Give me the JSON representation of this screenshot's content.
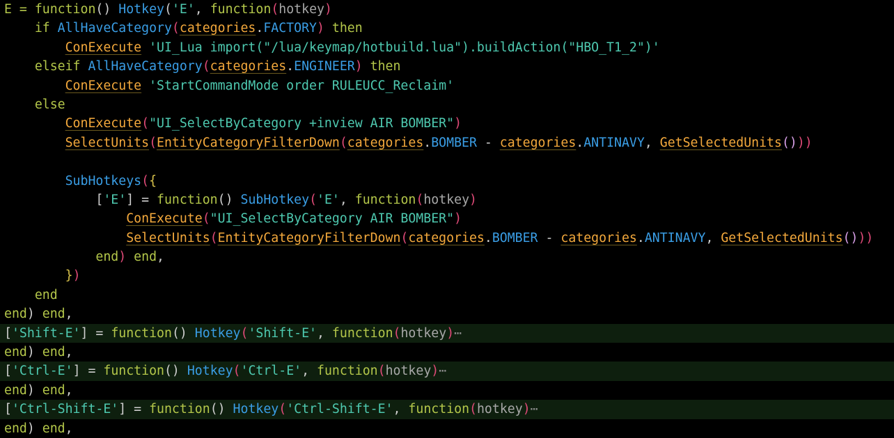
{
  "colors": {
    "background": "#000000",
    "folded_line_bg": "#0e1f0e",
    "keyword": "#b4c74a",
    "function_name": "#3a9ee6",
    "call": "#f4a93c",
    "string": "#4ec9b0",
    "paren": "#e04a78"
  },
  "lines": [
    [
      [
        "kw",
        "E = "
      ],
      [
        "kw",
        "function"
      ],
      [
        "punc",
        "() "
      ],
      [
        "fn",
        "Hotkey"
      ],
      [
        "punc",
        "("
      ],
      [
        "str",
        "'E'"
      ],
      [
        "punc",
        ", "
      ],
      [
        "kw",
        "function"
      ],
      [
        "paren",
        "("
      ],
      [
        "param",
        "hotkey"
      ],
      [
        "paren",
        ")"
      ]
    ],
    [
      [
        "punc",
        "    "
      ],
      [
        "kw",
        "if "
      ],
      [
        "fn",
        "AllHaveCategory"
      ],
      [
        "paren",
        "("
      ],
      [
        "callu",
        "categories"
      ],
      [
        "punc",
        "."
      ],
      [
        "prop",
        "FACTORY"
      ],
      [
        "paren",
        ")"
      ],
      [
        "kw",
        " then"
      ]
    ],
    [
      [
        "punc",
        "        "
      ],
      [
        "callu",
        "ConExecute"
      ],
      [
        "str",
        " 'UI_Lua import(\"/lua/keymap/hotbuild.lua\").buildAction(\"HBO_T1_2\")'"
      ]
    ],
    [
      [
        "punc",
        "    "
      ],
      [
        "kw",
        "elseif "
      ],
      [
        "fn",
        "AllHaveCategory"
      ],
      [
        "paren",
        "("
      ],
      [
        "callu",
        "categories"
      ],
      [
        "punc",
        "."
      ],
      [
        "prop",
        "ENGINEER"
      ],
      [
        "paren",
        ")"
      ],
      [
        "kw",
        " then"
      ]
    ],
    [
      [
        "punc",
        "        "
      ],
      [
        "callu",
        "ConExecute"
      ],
      [
        "str",
        " 'StartCommandMode order RULEUCC_Reclaim'"
      ]
    ],
    [
      [
        "punc",
        "    "
      ],
      [
        "kw",
        "else"
      ]
    ],
    [
      [
        "punc",
        "        "
      ],
      [
        "callu",
        "ConExecute"
      ],
      [
        "paren",
        "("
      ],
      [
        "str",
        "\"UI_SelectByCategory +inview AIR BOMBER\""
      ],
      [
        "paren",
        ")"
      ]
    ],
    [
      [
        "punc",
        "        "
      ],
      [
        "callu",
        "SelectUnits"
      ],
      [
        "paren",
        "("
      ],
      [
        "callu",
        "EntityCategoryFilterDown"
      ],
      [
        "paren",
        "("
      ],
      [
        "callu",
        "categories"
      ],
      [
        "punc",
        "."
      ],
      [
        "prop",
        "BOMBER"
      ],
      [
        "punc",
        " - "
      ],
      [
        "callu",
        "categories"
      ],
      [
        "punc",
        "."
      ],
      [
        "prop",
        "ANTINAVY"
      ],
      [
        "punc",
        ", "
      ],
      [
        "callu",
        "GetSelectedUnits"
      ],
      [
        "paren2",
        "()"
      ],
      [
        "paren",
        "))"
      ]
    ],
    [
      [
        "punc",
        " "
      ]
    ],
    [
      [
        "punc",
        "        "
      ],
      [
        "fn",
        "SubHotkeys"
      ],
      [
        "paren",
        "("
      ],
      [
        "brace",
        "{"
      ]
    ],
    [
      [
        "punc",
        "            "
      ],
      [
        "punc",
        "["
      ],
      [
        "str",
        "'E'"
      ],
      [
        "punc",
        "] = "
      ],
      [
        "kw",
        "function"
      ],
      [
        "punc",
        "() "
      ],
      [
        "fn",
        "SubHotkey"
      ],
      [
        "paren",
        "("
      ],
      [
        "str",
        "'E'"
      ],
      [
        "punc",
        ", "
      ],
      [
        "kw",
        "function"
      ],
      [
        "paren",
        "("
      ],
      [
        "param",
        "hotkey"
      ],
      [
        "paren",
        ")"
      ]
    ],
    [
      [
        "punc",
        "                "
      ],
      [
        "callu",
        "ConExecute"
      ],
      [
        "paren",
        "("
      ],
      [
        "str",
        "\"UI_SelectByCategory AIR BOMBER\""
      ],
      [
        "paren",
        ")"
      ]
    ],
    [
      [
        "punc",
        "                "
      ],
      [
        "callu",
        "SelectUnits"
      ],
      [
        "paren",
        "("
      ],
      [
        "callu",
        "EntityCategoryFilterDown"
      ],
      [
        "paren",
        "("
      ],
      [
        "callu",
        "categories"
      ],
      [
        "punc",
        "."
      ],
      [
        "prop",
        "BOMBER"
      ],
      [
        "punc",
        " - "
      ],
      [
        "callu",
        "categories"
      ],
      [
        "punc",
        "."
      ],
      [
        "prop",
        "ANTINAVY"
      ],
      [
        "punc",
        ", "
      ],
      [
        "callu",
        "GetSelectedUnits"
      ],
      [
        "paren2",
        "()"
      ],
      [
        "paren",
        "))"
      ]
    ],
    [
      [
        "punc",
        "            "
      ],
      [
        "kw",
        "end"
      ],
      [
        "paren",
        ")"
      ],
      [
        "kw",
        " end"
      ],
      [
        "punc",
        ","
      ]
    ],
    [
      [
        "punc",
        "        "
      ],
      [
        "brace",
        "}"
      ],
      [
        "paren",
        ")"
      ]
    ],
    [
      [
        "punc",
        "    "
      ],
      [
        "kw",
        "end"
      ]
    ],
    [
      [
        "kw",
        "end"
      ],
      [
        "punc",
        ") "
      ],
      [
        "kw",
        "end"
      ],
      [
        "punc",
        ","
      ]
    ],
    [
      [
        "punc",
        "["
      ],
      [
        "str",
        "'Shift-E'"
      ],
      [
        "punc",
        "] = "
      ],
      [
        "kw",
        "function"
      ],
      [
        "punc",
        "() "
      ],
      [
        "fn",
        "Hotkey"
      ],
      [
        "paren",
        "("
      ],
      [
        "str",
        "'Shift-E'"
      ],
      [
        "punc",
        ", "
      ],
      [
        "kw",
        "function"
      ],
      [
        "paren",
        "("
      ],
      [
        "param",
        "hotkey"
      ],
      [
        "paren",
        ")"
      ],
      [
        "ellipsis",
        "⋯"
      ]
    ],
    [
      [
        "kw",
        "end"
      ],
      [
        "punc",
        ") "
      ],
      [
        "kw",
        "end"
      ],
      [
        "punc",
        ","
      ]
    ],
    [
      [
        "punc",
        "["
      ],
      [
        "str",
        "'Ctrl-E'"
      ],
      [
        "punc",
        "] = "
      ],
      [
        "kw",
        "function"
      ],
      [
        "punc",
        "() "
      ],
      [
        "fn",
        "Hotkey"
      ],
      [
        "paren",
        "("
      ],
      [
        "str",
        "'Ctrl-E'"
      ],
      [
        "punc",
        ", "
      ],
      [
        "kw",
        "function"
      ],
      [
        "paren",
        "("
      ],
      [
        "param",
        "hotkey"
      ],
      [
        "paren",
        ")"
      ],
      [
        "ellipsis",
        "⋯"
      ]
    ],
    [
      [
        "kw",
        "end"
      ],
      [
        "punc",
        ") "
      ],
      [
        "kw",
        "end"
      ],
      [
        "punc",
        ","
      ]
    ],
    [
      [
        "punc",
        "["
      ],
      [
        "str",
        "'Ctrl-Shift-E'"
      ],
      [
        "punc",
        "] = "
      ],
      [
        "kw",
        "function"
      ],
      [
        "punc",
        "() "
      ],
      [
        "fn",
        "Hotkey"
      ],
      [
        "paren",
        "("
      ],
      [
        "str",
        "'Ctrl-Shift-E'"
      ],
      [
        "punc",
        ", "
      ],
      [
        "kw",
        "function"
      ],
      [
        "paren",
        "("
      ],
      [
        "param",
        "hotkey"
      ],
      [
        "paren",
        ")"
      ],
      [
        "ellipsis",
        "⋯"
      ]
    ],
    [
      [
        "kw",
        "end"
      ],
      [
        "punc",
        ") "
      ],
      [
        "kw",
        "end"
      ],
      [
        "punc",
        ","
      ]
    ]
  ],
  "folded_lines": [
    17,
    19,
    21
  ]
}
